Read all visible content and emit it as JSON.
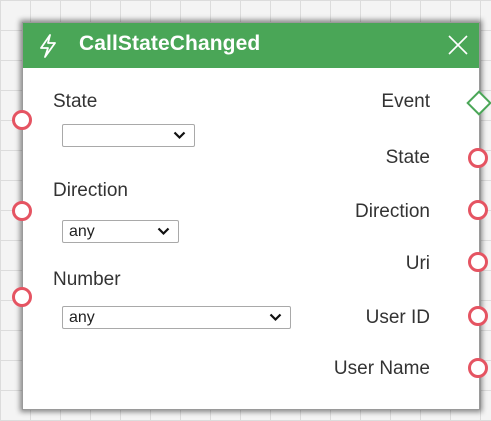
{
  "node": {
    "title": "CallStateChanged",
    "icon": "lightning-bolt-icon",
    "close_icon": "close-icon",
    "header_color": "#4aa657",
    "port_color": "#e55462"
  },
  "inputs": [
    {
      "label": "State",
      "value": ""
    },
    {
      "label": "Direction",
      "value": "any"
    },
    {
      "label": "Number",
      "value": "any"
    }
  ],
  "outputs": {
    "event": "Event",
    "state": "State",
    "direction": "Direction",
    "uri": "Uri",
    "user_id": "User ID",
    "user_name": "User Name"
  }
}
